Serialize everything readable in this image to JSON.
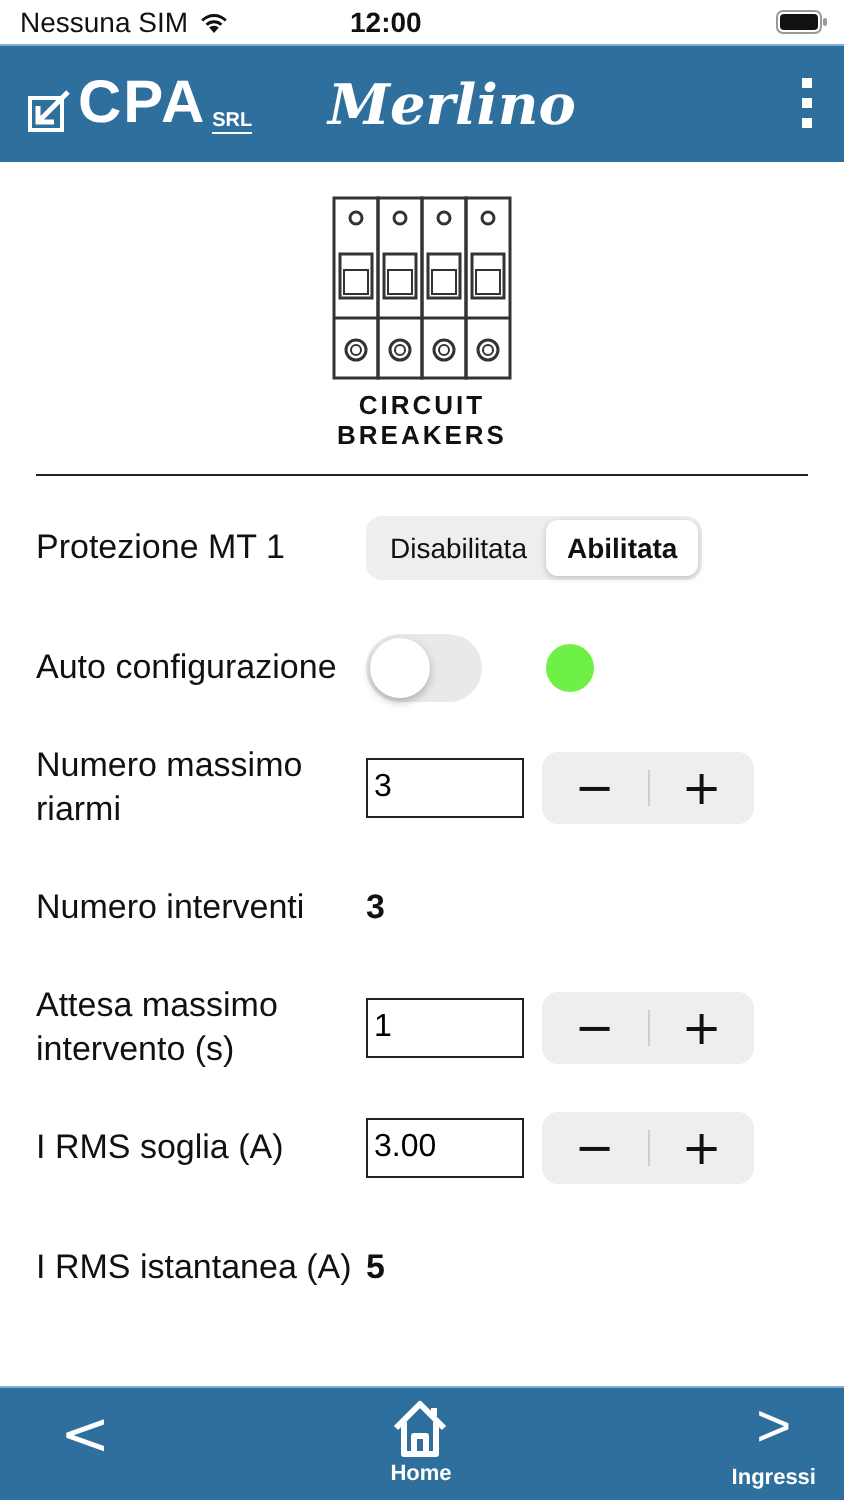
{
  "status_bar": {
    "carrier": "Nessuna SIM",
    "time": "12:00"
  },
  "header": {
    "logo_text": "CPA",
    "logo_suffix": "SRL",
    "title": "Merlino"
  },
  "device": {
    "caption_lines": [
      "CIRCUIT",
      "BREAKERS"
    ]
  },
  "rows": [
    {
      "kind": "segmented",
      "label": "Protezione MT 1",
      "options": [
        {
          "label": "Disabilitata",
          "selected": false
        },
        {
          "label": "Abilitata",
          "selected": true
        }
      ]
    },
    {
      "kind": "toggle",
      "label": "Auto configurazione",
      "on": false,
      "color": "#6ef046"
    },
    {
      "kind": "stepper",
      "label": "Numero massimo riarmi",
      "value": "3",
      "minus": "−",
      "plus": "+"
    },
    {
      "kind": "readout",
      "label": "Numero interventi",
      "value": "3"
    },
    {
      "kind": "stepper",
      "label": "Attesa massimo intervento (s)",
      "value": "1",
      "minus": "−",
      "plus": "+"
    },
    {
      "kind": "stepper",
      "label": "I RMS soglia (A)",
      "value": "3.00",
      "minus": "−",
      "plus": "+"
    },
    {
      "kind": "readout",
      "label": "I RMS istantanea (A)",
      "value": "5"
    }
  ],
  "bottom_bar": {
    "back": "<",
    "home": "Home",
    "forward": ">",
    "next_label": "Ingressi"
  }
}
